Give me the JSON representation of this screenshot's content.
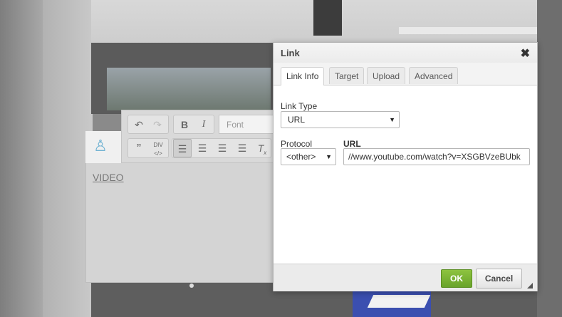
{
  "toolbar": {
    "undo_icon": "undo-icon",
    "redo_icon": "redo-icon",
    "bold_label": "B",
    "italic_label": "I",
    "font_placeholder": "Font",
    "blockquote_icon": "quote-icon",
    "div_label": "DIV",
    "align_left_icon": "align-left-icon",
    "align_center_icon": "align-center-icon",
    "align_right_icon": "align-right-icon",
    "justify_icon": "justify-icon",
    "remove_format_icon": "remove-format-icon"
  },
  "editor": {
    "content_text": "VIDEO"
  },
  "dialog": {
    "title": "Link",
    "tabs": [
      {
        "label": "Link Info",
        "active": true
      },
      {
        "label": "Target",
        "active": false
      },
      {
        "label": "Upload",
        "active": false
      },
      {
        "label": "Advanced",
        "active": false
      }
    ],
    "link_type_label": "Link Type",
    "link_type_value": "URL",
    "protocol_label": "Protocol",
    "protocol_value": "<other>",
    "url_label": "URL",
    "url_value": "//www.youtube.com/watch?v=XSGBVzeBUbk",
    "ok_label": "OK",
    "cancel_label": "Cancel"
  },
  "colors": {
    "ok_button": "#7ab536",
    "accent_icon": "#6fb2d2"
  }
}
